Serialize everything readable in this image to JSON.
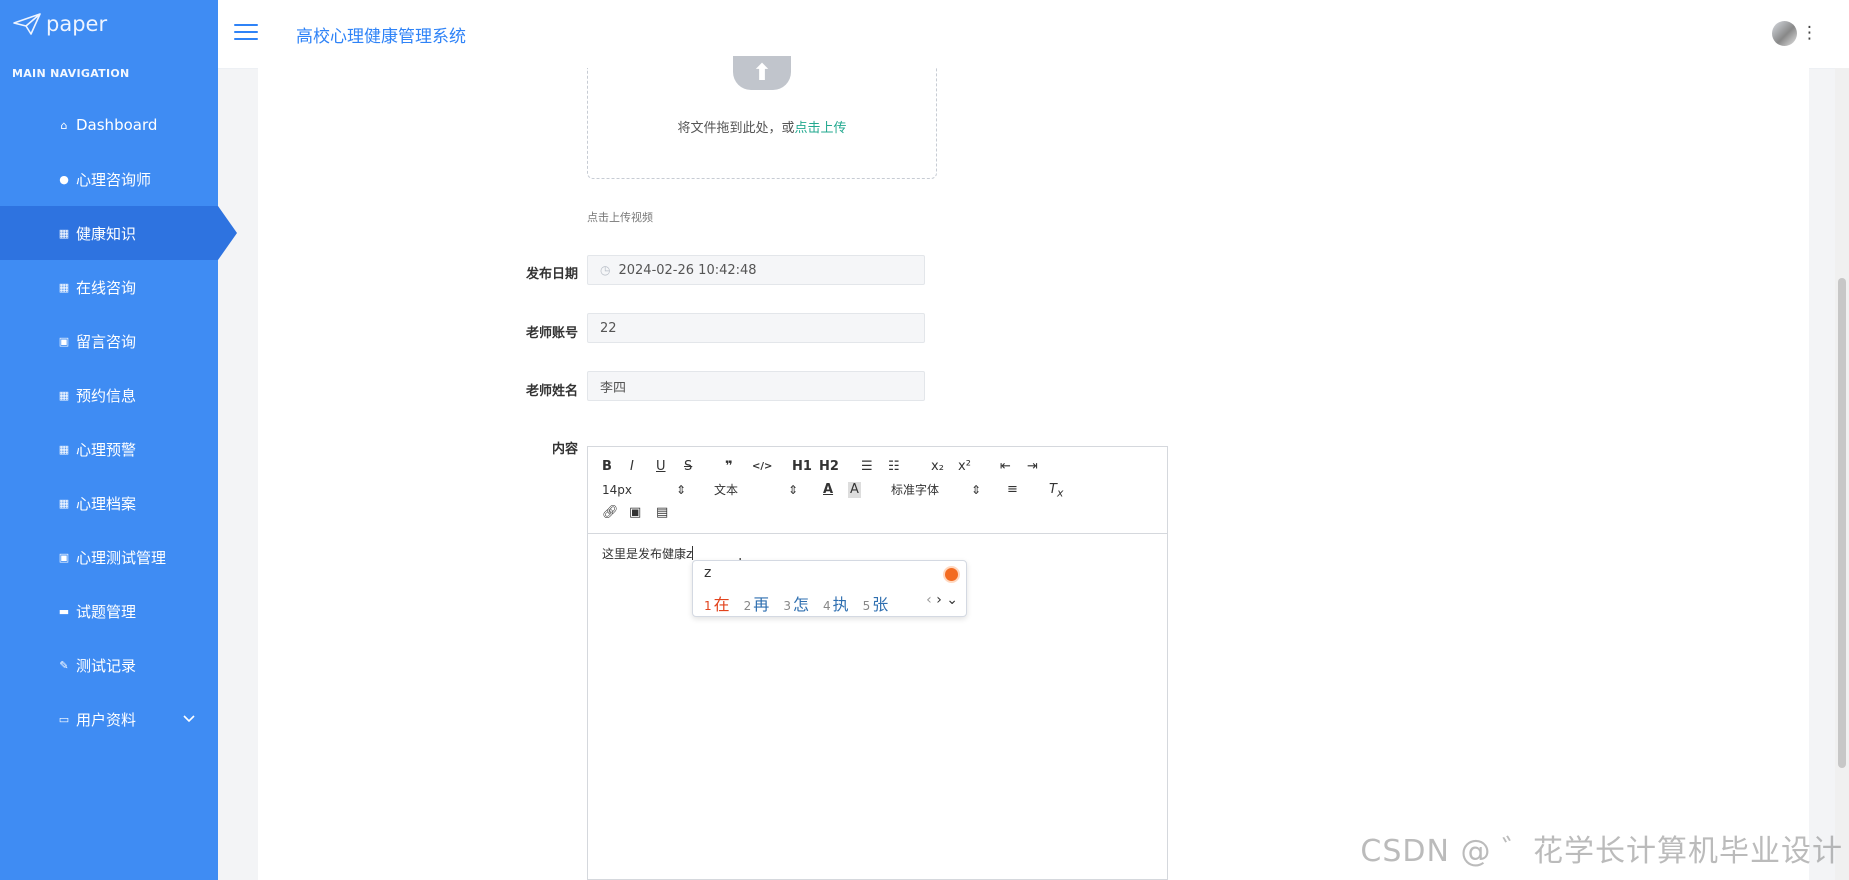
{
  "app": {
    "logo_text": "paper",
    "system_title": "高校心理健康管理系统"
  },
  "sidebar": {
    "section_title": "MAIN NAVIGATION",
    "items": [
      {
        "label": "Dashboard",
        "icon": "home-icon"
      },
      {
        "label": "心理咨询师",
        "icon": "pin-icon"
      },
      {
        "label": "健康知识",
        "icon": "grid-icon",
        "active": true
      },
      {
        "label": "在线咨询",
        "icon": "grid-icon"
      },
      {
        "label": "留言咨询",
        "icon": "clipboard-icon"
      },
      {
        "label": "预约信息",
        "icon": "grid-icon"
      },
      {
        "label": "心理预警",
        "icon": "grid-icon"
      },
      {
        "label": "心理档案",
        "icon": "grid-icon"
      },
      {
        "label": "心理测试管理",
        "icon": "clipboard-icon"
      },
      {
        "label": "试题管理",
        "icon": "comment-icon"
      },
      {
        "label": "测试记录",
        "icon": "edit-icon"
      },
      {
        "label": "用户资料",
        "icon": "card-icon",
        "has_children": true
      }
    ]
  },
  "upload": {
    "drag_text": "将文件拖到此处，或",
    "click_text": "点击上传",
    "hint": "点击上传视频"
  },
  "form": {
    "publish_date": {
      "label": "发布日期",
      "value": "2024-02-26 10:42:48"
    },
    "teacher_account": {
      "label": "老师账号",
      "value": "22"
    },
    "teacher_name": {
      "label": "老师姓名",
      "value": "李四"
    },
    "content": {
      "label": "内容",
      "text": "这里是发布健康z"
    }
  },
  "editor": {
    "toolbar": {
      "row1": [
        "B",
        "I",
        "U",
        "S",
        "❞",
        "</>",
        "H1",
        "H2",
        "ordered-list-icon",
        "bullet-list-icon",
        "x₂",
        "x²",
        "outdent-icon",
        "indent-icon"
      ],
      "font_size": "14px",
      "paragraph": "文本",
      "font_family": "标准字体"
    }
  },
  "ime": {
    "input": "z",
    "candidates": [
      {
        "num": "1",
        "text": "在"
      },
      {
        "num": "2",
        "text": "再"
      },
      {
        "num": "3",
        "text": "怎"
      },
      {
        "num": "4",
        "text": "执"
      },
      {
        "num": "5",
        "text": "张"
      }
    ]
  },
  "watermark": "CSDN @ ゛花学长计算机毕业设计"
}
